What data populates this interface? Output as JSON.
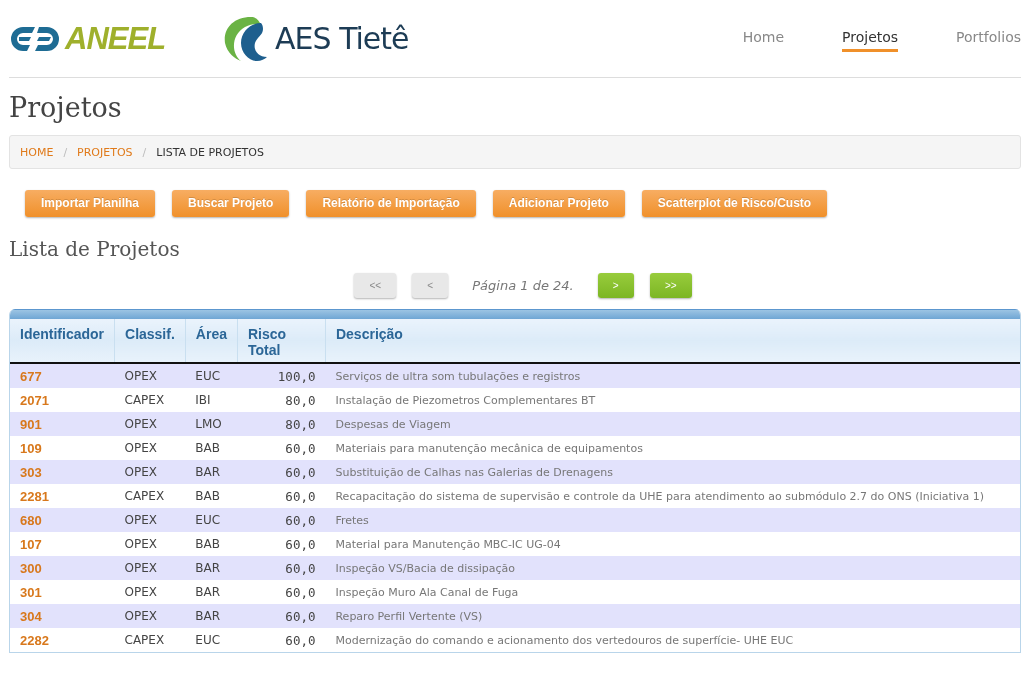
{
  "header": {
    "logos": [
      {
        "kind": "aneel",
        "text": "ANEEL"
      },
      {
        "kind": "aes",
        "text": "AES Tietê"
      }
    ],
    "nav": [
      {
        "label": "Home",
        "selected": false
      },
      {
        "label": "Projetos",
        "selected": true
      },
      {
        "label": "Portfolios",
        "selected": false
      }
    ]
  },
  "page_title": "Projetos",
  "breadcrumb": [
    {
      "label": "HOME",
      "link": true,
      "separator": "/"
    },
    {
      "label": "PROJETOS",
      "link": true,
      "separator": "/"
    },
    {
      "label": "LISTA DE PROJETOS",
      "link": false
    }
  ],
  "actions": [
    "Importar Planilha",
    "Buscar Projeto",
    "Relatório de Importação",
    "Adicionar Projeto",
    "Scatterplot de Risco/Custo"
  ],
  "section_title": "Lista de Projetos",
  "pagination": {
    "before": [
      {
        "label": "<<",
        "disabled": true
      },
      {
        "label": "<",
        "disabled": true
      }
    ],
    "text": "Página 1 de 24.",
    "after": [
      {
        "label": ">",
        "disabled": false
      },
      {
        "label": ">>",
        "disabled": false
      }
    ]
  },
  "table": {
    "columns": [
      "Identificador",
      "Classif.",
      "Área",
      "Risco Total",
      "Descrição"
    ],
    "rows": [
      [
        "677",
        "OPEX",
        "EUC",
        "100,0",
        "Serviços de ultra som tubulações e registros"
      ],
      [
        "2071",
        "CAPEX",
        "IBI",
        "80,0",
        "Instalação de Piezometros Complementares BT"
      ],
      [
        "901",
        "OPEX",
        "LMO",
        "80,0",
        "Despesas de Viagem"
      ],
      [
        "109",
        "OPEX",
        "BAB",
        "60,0",
        "Materiais para manutenção mecânica de equipamentos"
      ],
      [
        "303",
        "OPEX",
        "BAR",
        "60,0",
        "Substituição de Calhas nas Galerias de Drenagens"
      ],
      [
        "2281",
        "CAPEX",
        "BAB",
        "60,0",
        "Recapacitação do sistema de supervisão e controle da UHE para atendimento ao submódulo 2.7 do ONS (Iniciativa 1)"
      ],
      [
        "680",
        "OPEX",
        "EUC",
        "60,0",
        "Fretes"
      ],
      [
        "107",
        "OPEX",
        "BAB",
        "60,0",
        "Material para Manutenção MBC-IC UG-04"
      ],
      [
        "300",
        "OPEX",
        "BAR",
        "60,0",
        "Inspeção VS/Bacia de dissipação"
      ],
      [
        "301",
        "OPEX",
        "BAR",
        "60,0",
        "Inspeção Muro Ala Canal de Fuga"
      ],
      [
        "304",
        "OPEX",
        "BAR",
        "60,0",
        "Reparo Perfil Vertente (VS)"
      ],
      [
        "2282",
        "CAPEX",
        "EUC",
        "60,0",
        "Modernização do comando e acionamento dos vertedouros de superfície- UHE EUC"
      ]
    ]
  }
}
